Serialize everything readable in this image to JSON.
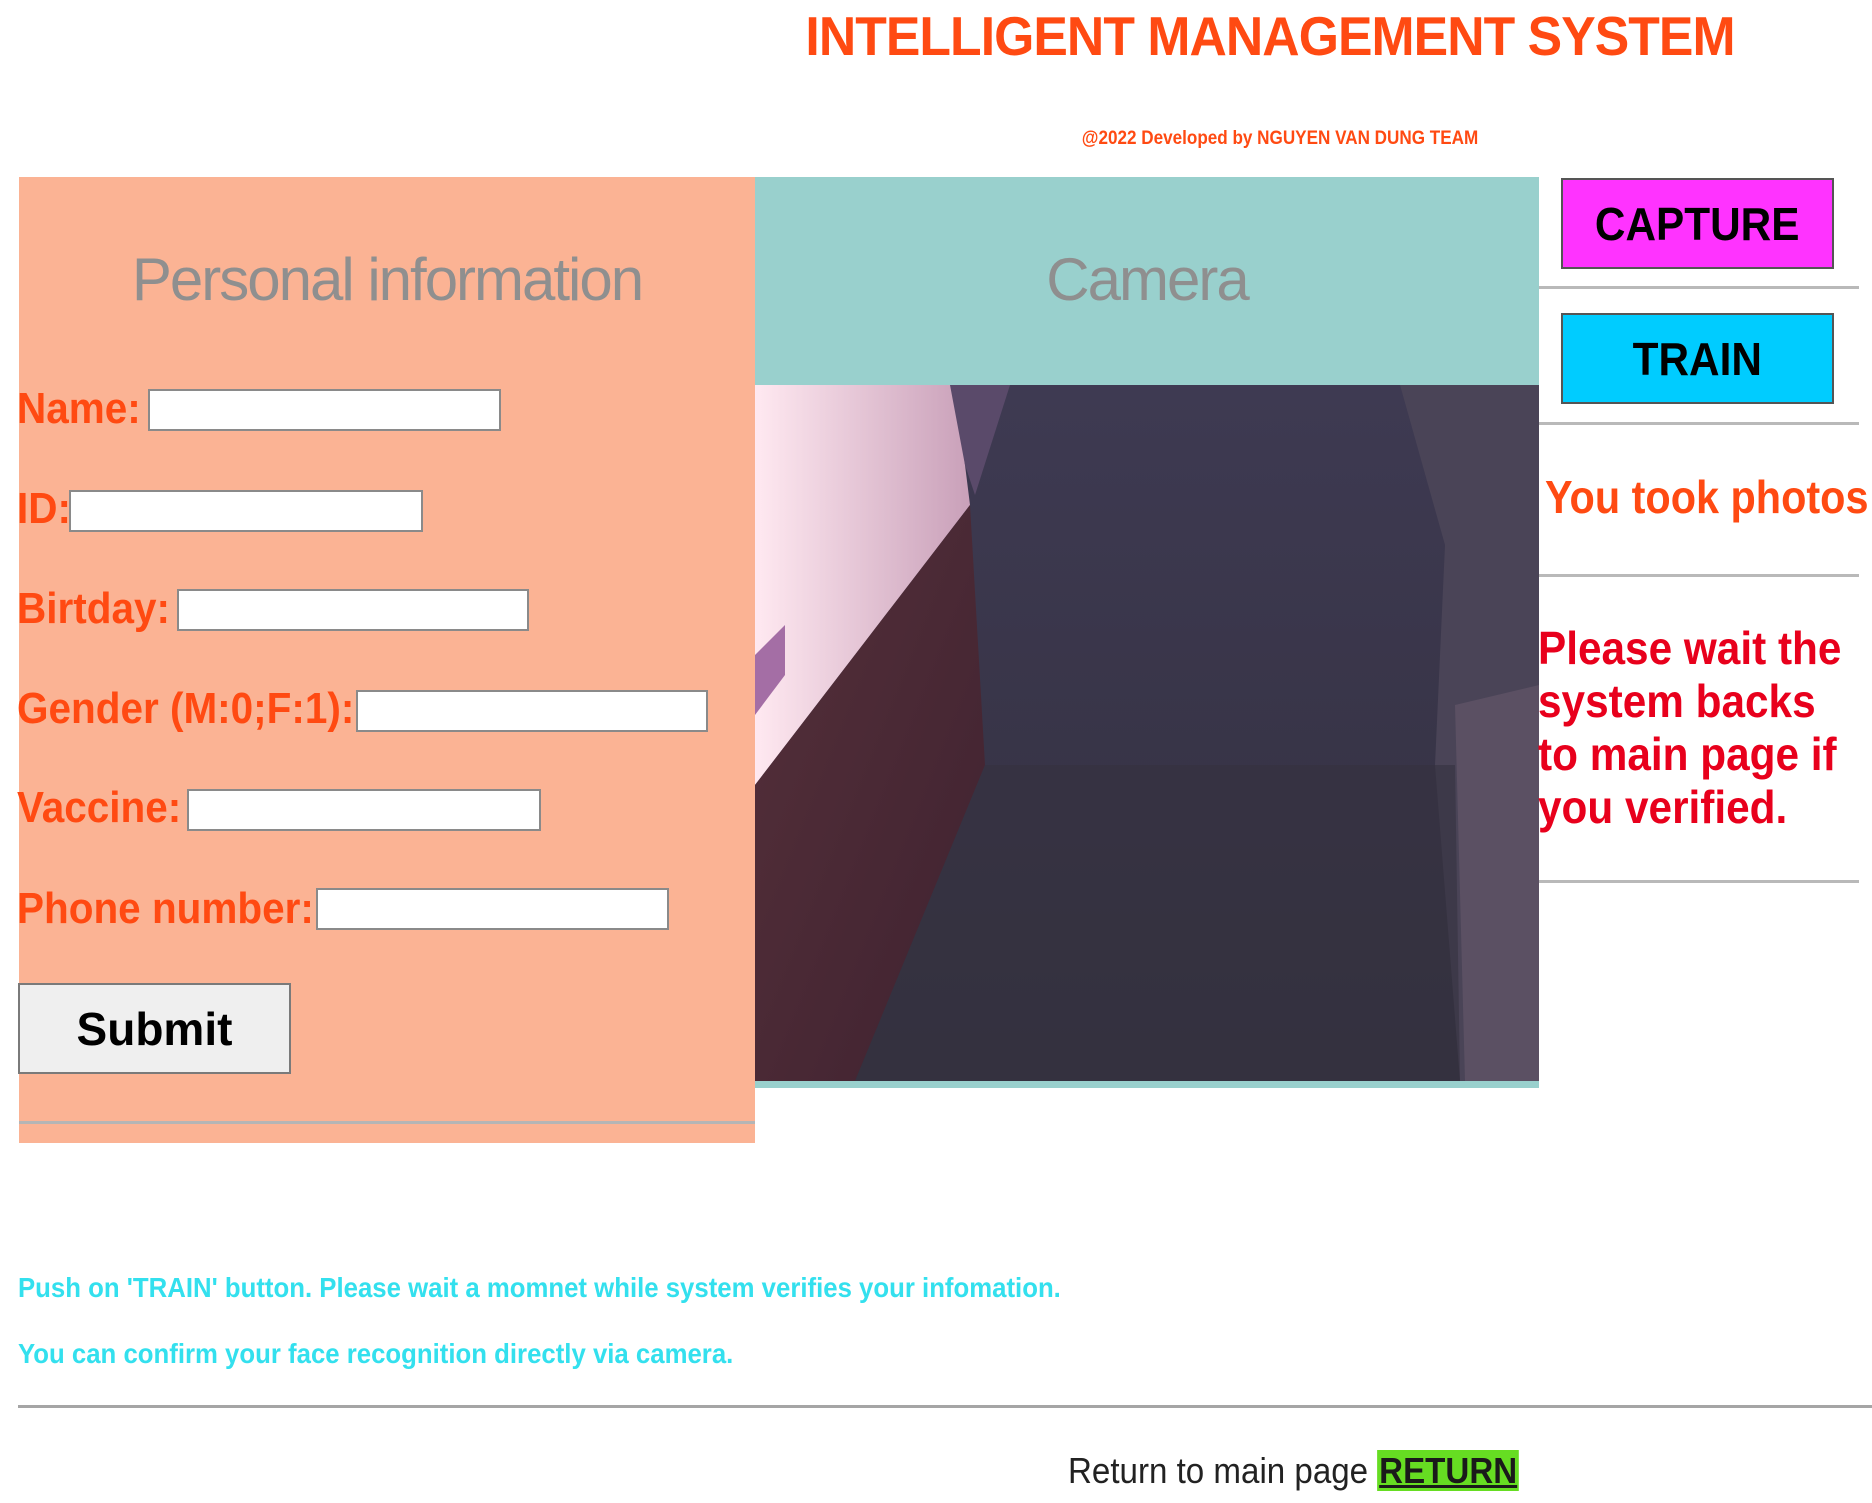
{
  "header": {
    "title": "INTELLIGENT MANAGEMENT SYSTEM",
    "credit": "@2022 Developed by NGUYEN VAN DUNG TEAM"
  },
  "personal_info": {
    "heading": "Personal information",
    "fields": [
      {
        "label": "Name:",
        "value": ""
      },
      {
        "label": "ID:",
        "value": ""
      },
      {
        "label": "Birtday:",
        "value": ""
      },
      {
        "label": "Gender (M:0;F:1):",
        "value": ""
      },
      {
        "label": "Vaccine:",
        "value": ""
      },
      {
        "label": "Phone number:",
        "value": ""
      }
    ],
    "submit_label": "Submit"
  },
  "camera": {
    "heading": "Camera"
  },
  "actions": {
    "capture_label": "CAPTURE",
    "train_label": "TRAIN",
    "status": "You took photos",
    "wait_message": "Please wait the system backs to main page if you verified."
  },
  "instructions": {
    "line1": "Push on 'TRAIN' button. Please wait a momnet while system verifies your infomation.",
    "line2": "You can confirm your face recognition directly via camera."
  },
  "footer": {
    "return_text": "Return to main page",
    "return_link": "RETURN"
  },
  "colors": {
    "title": "#ff4a12",
    "field_label": "#ff4a12",
    "personal_panel_bg": "#fbb394",
    "camera_panel_bg": "#99d0cd",
    "panel_heading": "#8f8f8f",
    "capture_bg": "#ff33ff",
    "train_bg": "#00ccff",
    "status_text": "#ff4a12",
    "wait_text": "#e8001c",
    "instructions": "#33e0ee",
    "return_link_bg": "#66dd22"
  }
}
